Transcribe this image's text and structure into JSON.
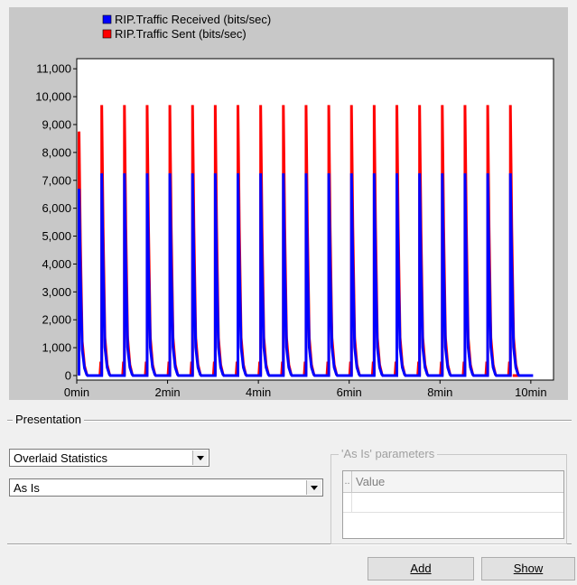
{
  "chart_data": {
    "type": "line",
    "legend": [
      {
        "name": "RIP.Traffic Received (bits/sec)",
        "color": "#0000ff"
      },
      {
        "name": "RIP.Traffic Sent (bits/sec)",
        "color": "#ff0000"
      }
    ],
    "x_tick_labels": [
      "0min",
      "2min",
      "4min",
      "6min",
      "8min",
      "10min"
    ],
    "x_tick_minutes": [
      0,
      2,
      4,
      6,
      8,
      10
    ],
    "xlim_minutes": [
      0,
      10.5
    ],
    "y_tick_values": [
      0,
      1000,
      2000,
      3000,
      4000,
      5000,
      6000,
      7000,
      8000,
      9000,
      10000,
      11000
    ],
    "y_tick_labels": [
      "0",
      "1,000",
      "2,000",
      "3,000",
      "4,000",
      "5,000",
      "6,000",
      "7,000",
      "8,000",
      "9,000",
      "10,000",
      "11,000"
    ],
    "ylim": [
      0,
      11200
    ],
    "grid": false,
    "plot_background": "#ffffff",
    "panel_background": "#c8c8c8",
    "series": [
      {
        "name": "RIP.Traffic Received (bits/sec)",
        "color": "#0000ff",
        "peak_minutes": [
          0.05,
          0.55,
          1.05,
          1.55,
          2.05,
          2.55,
          3.05,
          3.55,
          4.05,
          4.55,
          5.05,
          5.55,
          6.05,
          6.55,
          7.05,
          7.55,
          8.05,
          8.55,
          9.05,
          9.55
        ],
        "peak_values": [
          6700,
          7250,
          7250,
          7250,
          7250,
          7250,
          7250,
          7250,
          7250,
          7250,
          7250,
          7250,
          7250,
          7250,
          7250,
          7250,
          7250,
          7250,
          7250,
          7250
        ],
        "end_minute": 10.05
      },
      {
        "name": "RIP.Traffic Sent (bits/sec)",
        "color": "#ff0000",
        "peak_minutes": [
          0.05,
          0.55,
          1.05,
          1.55,
          2.05,
          2.55,
          3.05,
          3.55,
          4.05,
          4.55,
          5.05,
          5.55,
          6.05,
          6.55,
          7.05,
          7.55,
          8.05,
          8.55,
          9.05,
          9.55
        ],
        "peak_values": [
          8750,
          9700,
          9700,
          9700,
          9700,
          9700,
          9700,
          9700,
          9700,
          9700,
          9700,
          9700,
          9700,
          9700,
          9700,
          9700,
          9700,
          9700,
          9700,
          9700
        ],
        "end_minute": 9.6
      }
    ]
  },
  "presentation": {
    "group_title": "Presentation",
    "statistics_select": "Overlaid Statistics",
    "filter_select": "As Is"
  },
  "as_is_parameters": {
    "title": "'As Is' parameters",
    "header_dots": "..",
    "header_value": "Value"
  },
  "buttons": {
    "add": "Add",
    "show": "Show"
  }
}
